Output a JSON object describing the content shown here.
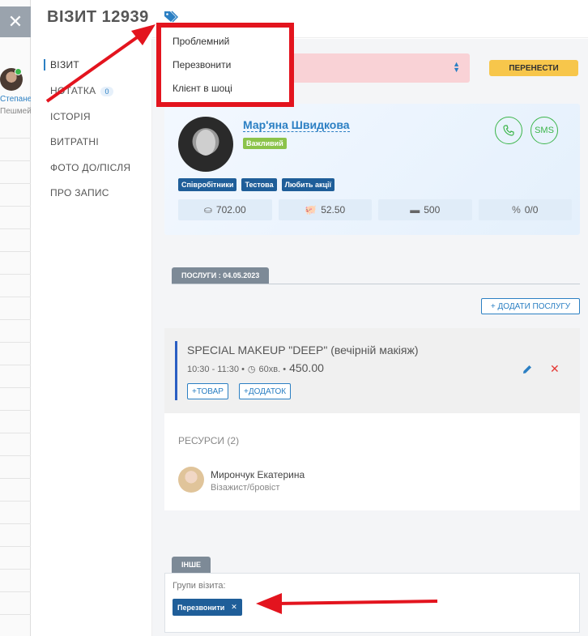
{
  "background": {
    "close_glyph": "✕",
    "staff_name": "Степане",
    "staff_sub": "Пешмей"
  },
  "modal": {
    "title": "ВІЗИТ 12939"
  },
  "nav": {
    "items": [
      {
        "label": "ВІЗИТ"
      },
      {
        "label": "НОТАТКА",
        "badge": "0"
      },
      {
        "label": "ІСТОРІЯ"
      },
      {
        "label": "ВИТРАТНІ"
      },
      {
        "label": "ФОТО ДО/ПІСЛЯ"
      },
      {
        "label": "ПРО ЗАПИС"
      }
    ]
  },
  "status": {
    "move_button": "ПЕРЕНЕСТИ"
  },
  "client": {
    "name": "Мар'яна Швидкова",
    "badge": "Важливий",
    "sms_label": "SMS",
    "tags": [
      "Співробітники",
      "Тестова",
      "Любить акції"
    ],
    "stats": [
      {
        "icon": "hand-coin-icon",
        "value": "702.00"
      },
      {
        "icon": "piggy-bank-icon",
        "value": "52.50"
      },
      {
        "icon": "card-icon",
        "value": "500"
      },
      {
        "icon": "percent-icon",
        "value": "0/0"
      }
    ]
  },
  "services": {
    "tab_label": "ПОСЛУГИ : 04.05.2023",
    "add_button": "+ ДОДАТИ ПОСЛУГУ",
    "item": {
      "name": "SPECIAL MAKEUP \"DEEP\" (вечірній макіяж)",
      "time": "10:30 - 11:30 •",
      "duration": "60хв. •",
      "price": "450.00",
      "add_product": "+ТОВАР",
      "add_extra": "+ДОДАТОК"
    }
  },
  "resources": {
    "title": "РЕСУРСИ (2)",
    "person_name": "Мирончук Екатерина",
    "person_role": "Візажист/бровіст"
  },
  "other": {
    "tab_label": "ІНШЕ",
    "groups_label": "Групи візита:",
    "group_chip": "Перезвонити",
    "group_remove": "✕"
  },
  "dropdown": {
    "items": [
      "Проблемний",
      "Перезвонити",
      "Клієнт в шоці"
    ]
  },
  "colors": {
    "accent": "#2b7fc3",
    "tag_dark": "#1f5e99",
    "warning": "#f7c64b",
    "status_bg": "#f9d2d6",
    "highlight_red": "#e3141e",
    "success": "#3bb54a"
  }
}
